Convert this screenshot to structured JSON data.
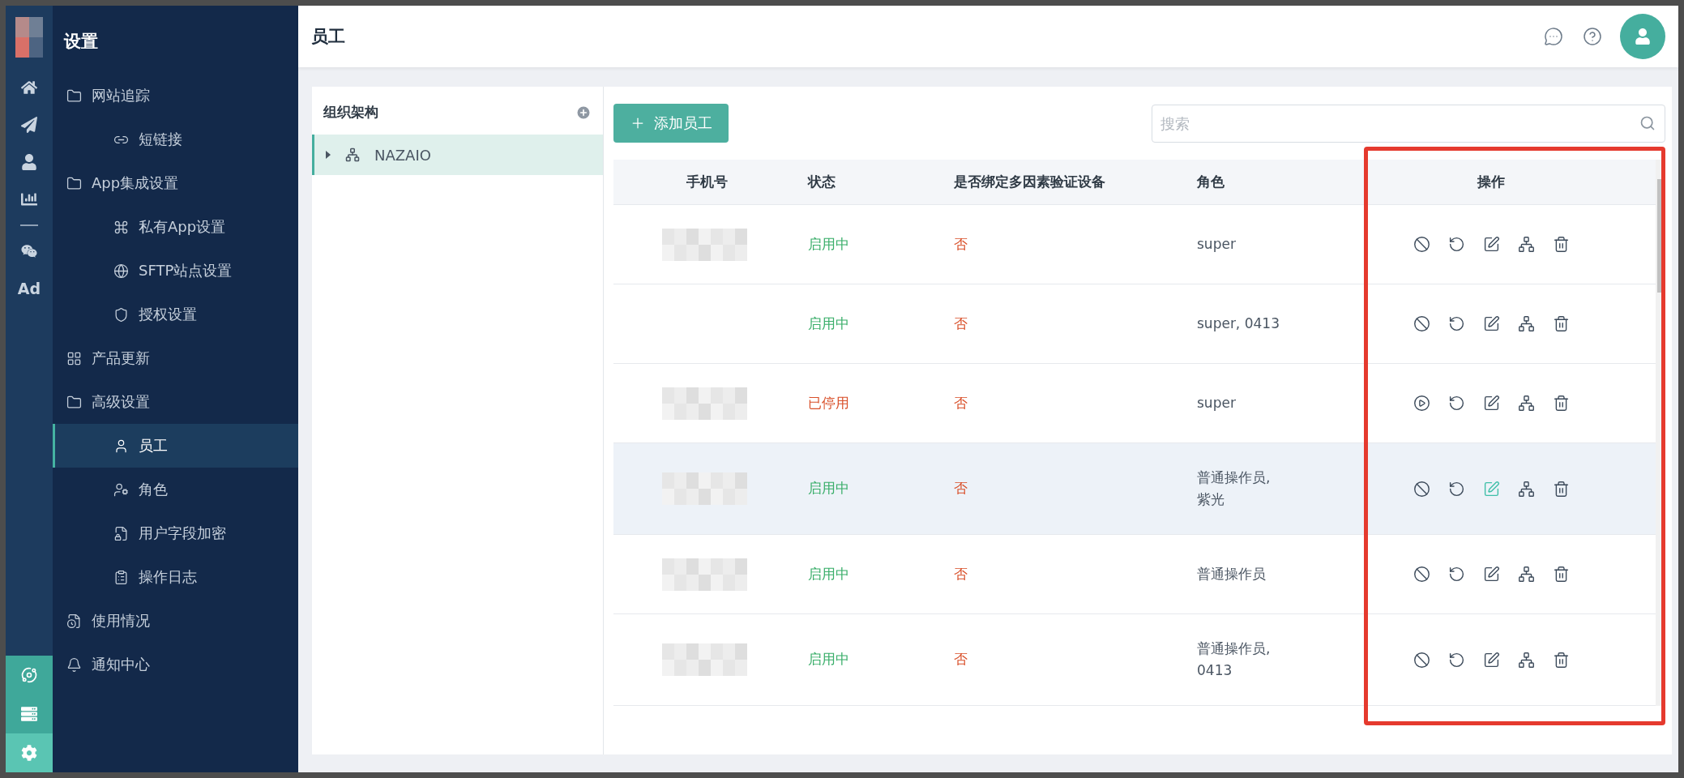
{
  "rail": {
    "top": [
      {
        "kind": "icon"
      },
      {
        "kind": "icon"
      },
      {
        "kind": "icon"
      },
      {
        "kind": "icon"
      },
      {
        "kind": "divider"
      },
      {
        "kind": "icon"
      },
      {
        "kind": "text",
        "label": "Ad"
      }
    ],
    "bottom": [
      {
        "selected": false
      },
      {
        "selected": false
      },
      {
        "selected": true
      }
    ]
  },
  "sidebar": {
    "title": "设置",
    "items": [
      {
        "label": "网站追踪",
        "selected": false,
        "children": [
          {
            "label": "短链接",
            "selected": false
          }
        ]
      },
      {
        "label": "App集成设置",
        "selected": false,
        "children": [
          {
            "label": "私有App设置",
            "selected": false
          },
          {
            "label": "SFTP站点设置",
            "selected": false
          },
          {
            "label": "授权设置",
            "selected": false
          }
        ]
      },
      {
        "label": "产品更新",
        "selected": false
      },
      {
        "label": "高级设置",
        "selected": false,
        "children": [
          {
            "label": "员工",
            "selected": true
          },
          {
            "label": "角色",
            "selected": false
          },
          {
            "label": "用户字段加密",
            "selected": false
          },
          {
            "label": "操作日志",
            "selected": false
          }
        ]
      },
      {
        "label": "使用情况",
        "selected": false
      },
      {
        "label": "通知中心",
        "selected": false
      }
    ]
  },
  "header": {
    "title": "员工"
  },
  "org": {
    "title": "组织架构",
    "tree": [
      {
        "label": "NAZAIO",
        "selected": true,
        "expanded": false
      }
    ]
  },
  "toolbar": {
    "add_button": "添加员工",
    "search": {
      "placeholder": "搜索"
    }
  },
  "table": {
    "columns": [
      "手机号",
      "状态",
      "是否绑定多因素验证设备",
      "角色",
      "操作"
    ],
    "rows": [
      {
        "phone": {
          "kind": "redacted"
        },
        "status": "启用中",
        "enabled": true,
        "mfa": "否",
        "role": "super",
        "hovered": false
      },
      {
        "phone": {
          "kind": "empty"
        },
        "status": "启用中",
        "enabled": true,
        "mfa": "否",
        "role": "super, 0413",
        "hovered": false
      },
      {
        "phone": {
          "kind": "redacted"
        },
        "status": "已停用",
        "enabled": false,
        "mfa": "否",
        "role": "super",
        "hovered": false
      },
      {
        "phone": {
          "kind": "redacted"
        },
        "status": "启用中",
        "enabled": true,
        "mfa": "否",
        "role": "普通操作员,\n紫光",
        "hovered": true
      },
      {
        "phone": {
          "kind": "redacted"
        },
        "status": "启用中",
        "enabled": true,
        "mfa": "否",
        "role": "普通操作员",
        "hovered": false
      },
      {
        "phone": {
          "kind": "redacted"
        },
        "status": "启用中",
        "enabled": true,
        "mfa": "否",
        "role": "普通操作员,\n0413",
        "hovered": false
      }
    ]
  },
  "annotation": {
    "kind": "rectangle"
  }
}
